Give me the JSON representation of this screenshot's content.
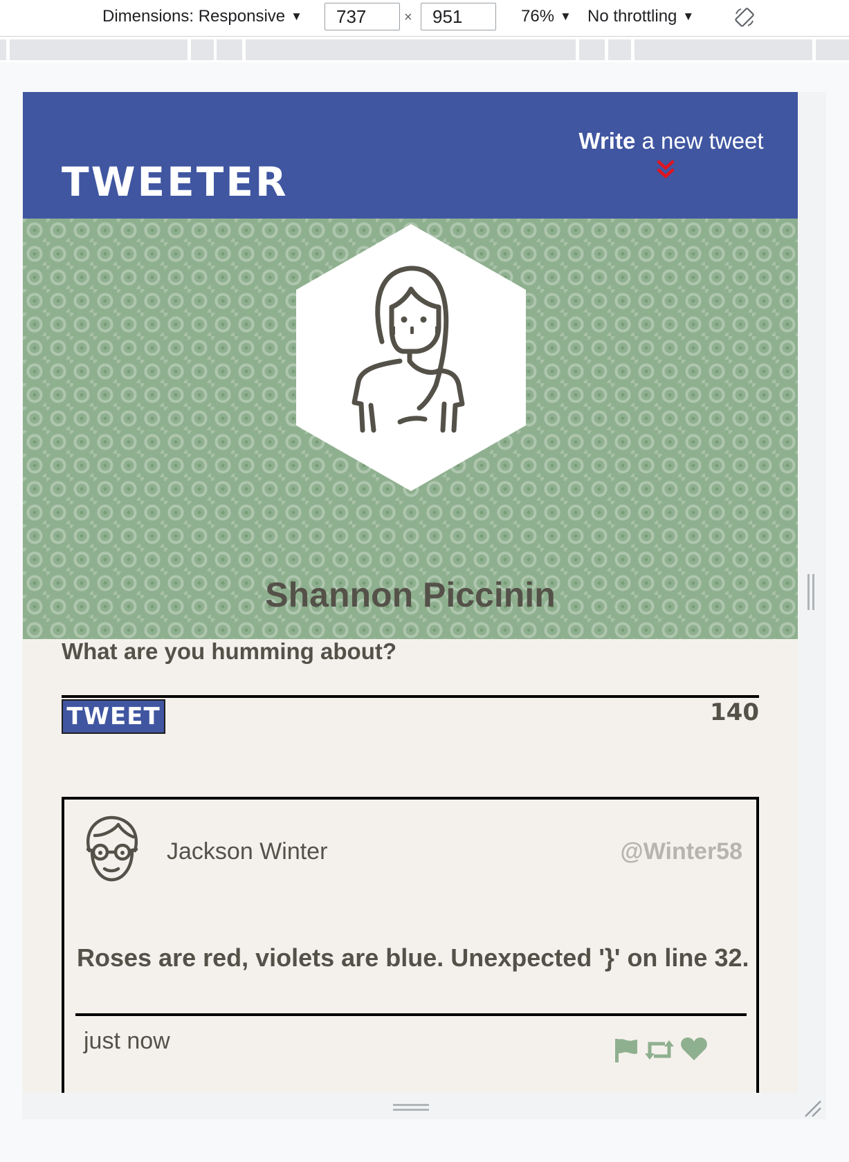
{
  "devtools": {
    "dimensions_label": "Dimensions: Responsive",
    "width_value": "737",
    "times": "×",
    "height_value": "951",
    "zoom": "76%",
    "throttling": "No throttling",
    "caret": "▼"
  },
  "nav": {
    "brand": "Tweeter",
    "compose_bold": "Write",
    "compose_rest": " a new tweet"
  },
  "profile": {
    "name": "Shannon Piccinin"
  },
  "composer": {
    "label": "What are you humming about?",
    "button_label": "Tweet",
    "counter": "140"
  },
  "tweet": {
    "author_name": "Jackson Winter",
    "handle": "@Winter58",
    "content": "Roses are red, violets are blue. Unexpected '}' on line 32.",
    "timestamp": "just now",
    "icons": [
      "flag-icon",
      "retweet-icon",
      "heart-icon"
    ],
    "icon_color": "#8fb08f"
  },
  "colors": {
    "nav_bg": "#4056a1",
    "accent_red": "#e0141e",
    "header_bg": "#8fb08f",
    "page_bg": "#f4f1ec",
    "text": "#545149"
  }
}
